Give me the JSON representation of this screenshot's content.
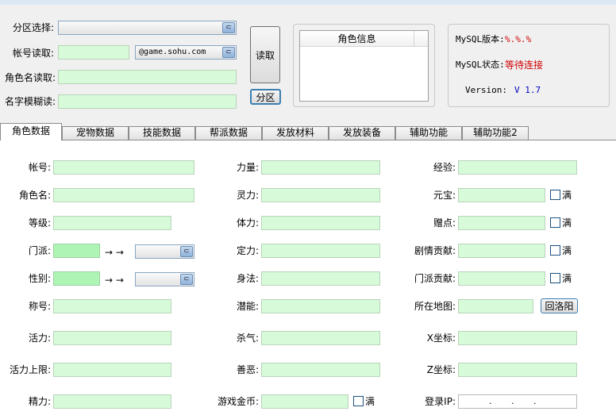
{
  "top": {
    "zone_label": "分区选择:",
    "account_label": "帐号读取:",
    "domain_value": "@game.sohu.com",
    "rolename_read_label": "角色名读取:",
    "fuzzy_label": "名字模糊读:",
    "read_button": "读取",
    "zone_button": "分区",
    "role_info_header": "角色信息",
    "mysql_version_label": "MySQL版本:",
    "mysql_version_value": "%.%.%",
    "mysql_status_label": "MySQL状态:",
    "mysql_status_value": "等待连接",
    "version_label": "Version:",
    "version_value": "V 1.7"
  },
  "tabs": [
    "角色数据",
    "宠物数据",
    "技能数据",
    "帮派数据",
    "发放材料",
    "发放装备",
    "辅助功能",
    "辅助功能2"
  ],
  "form": {
    "col1": [
      "帐号:",
      "角色名:",
      "等级:",
      "门派:",
      "性别:",
      "称号:",
      "活力:",
      "活力上限:",
      "精力:"
    ],
    "col2": [
      "力量:",
      "灵力:",
      "体力:",
      "定力:",
      "身法:",
      "潜能:",
      "杀气:",
      "善恶:",
      "游戏金币:"
    ],
    "col3": [
      "经验:",
      "元宝:",
      "赠点:",
      "剧情贡献:",
      "门派贡献:",
      "所在地图:",
      "X坐标:",
      "Z坐标:",
      "登录IP:"
    ],
    "full_label": "满",
    "arrow_text": "→ →",
    "return_button": "回洛阳",
    "ip_value": ".       .       ."
  },
  "colors": {
    "field_bg": "#d7fbd8",
    "status_red": "#d00000",
    "version_blue": "#0000c0"
  }
}
